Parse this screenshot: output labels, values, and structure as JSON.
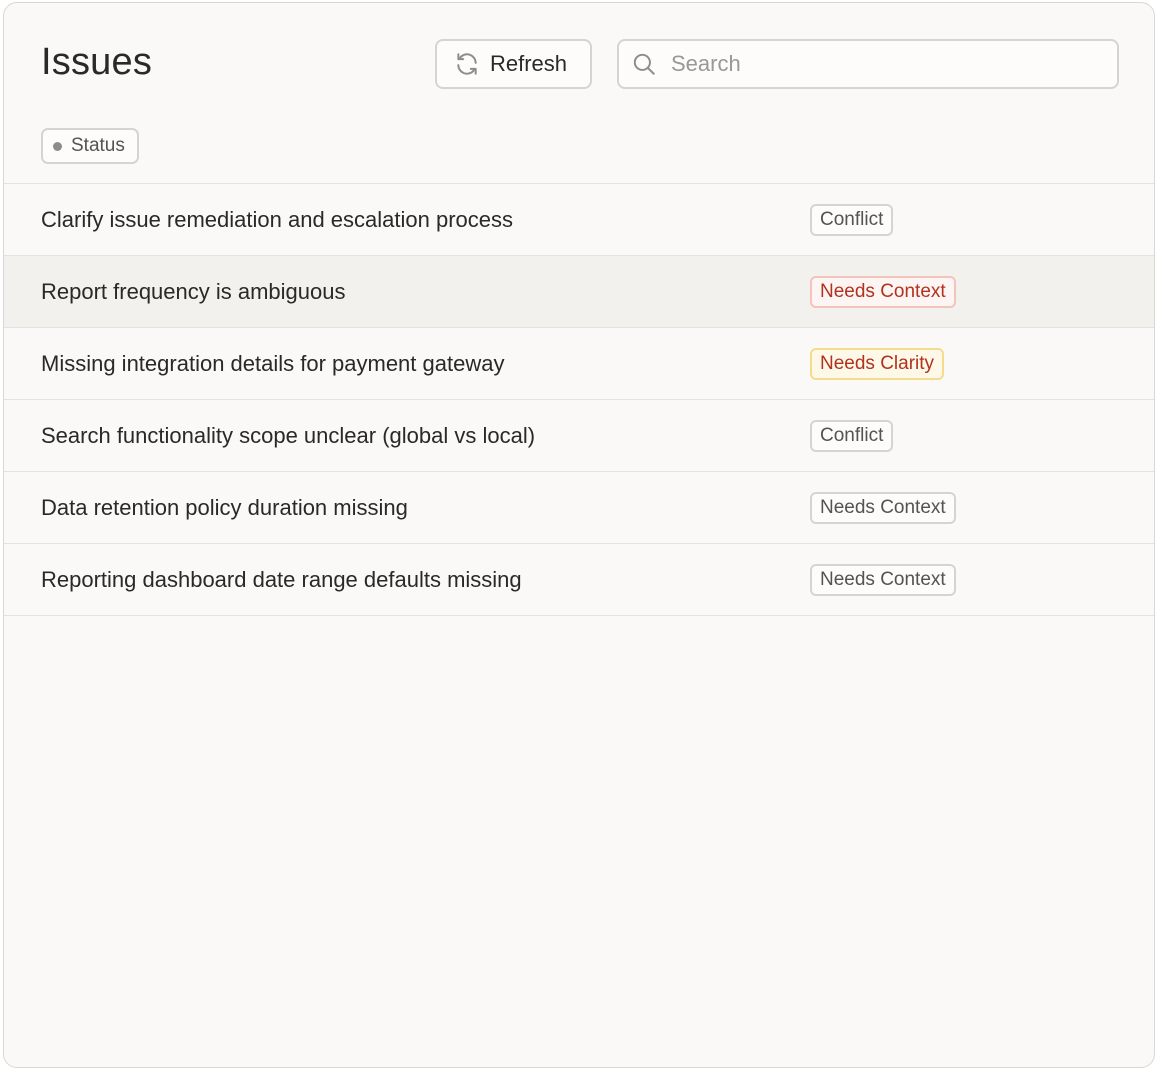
{
  "header": {
    "title": "Issues",
    "refresh_label": "Refresh",
    "search_placeholder": "Search",
    "search_value": ""
  },
  "filters": {
    "status_label": "Status"
  },
  "issues": [
    {
      "title": "Clarify issue remediation and escalation process",
      "status": "Conflict",
      "tone": "neutral"
    },
    {
      "title": "Report frequency is ambiguous",
      "status": "Needs Context",
      "tone": "red"
    },
    {
      "title": "Missing integration details for payment gateway",
      "status": "Needs Clarity",
      "tone": "yellow"
    },
    {
      "title": "Search functionality scope unclear (global vs local)",
      "status": "Conflict",
      "tone": "neutral"
    },
    {
      "title": "Data retention policy duration missing",
      "status": "Needs Context",
      "tone": "neutral"
    },
    {
      "title": "Reporting dashboard date range defaults missing",
      "status": "Needs Context",
      "tone": "neutral"
    }
  ],
  "colors": {
    "background": "#faf9f7",
    "text": "#2a2926",
    "red_text": "#b2321d",
    "red_border": "#f2c4bb",
    "yellow_border": "#f4dc8e",
    "border": "#d6d4d0"
  }
}
